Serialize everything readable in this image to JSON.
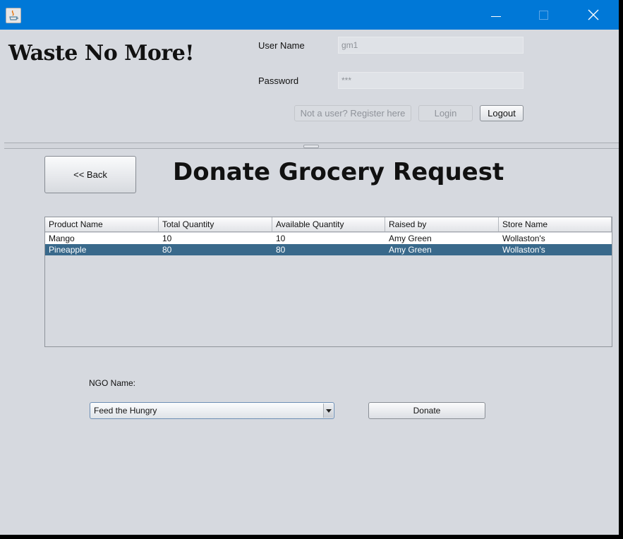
{
  "brand": {
    "title": "Waste No More!"
  },
  "login": {
    "username_label": "User Name",
    "username_value": "gm1",
    "password_label": "Password",
    "password_value": "***",
    "register_label": "Not a user? Register here",
    "login_label": "Login",
    "logout_label": "Logout"
  },
  "page": {
    "back_label": "<< Back",
    "title": "Donate Grocery Request"
  },
  "table": {
    "columns": [
      "Product Name",
      "Total Quantity",
      "Available Quantity",
      "Raised by",
      "Store Name"
    ],
    "rows": [
      [
        "Mango",
        "10",
        "10",
        "Amy Green",
        "Wollaston's"
      ],
      [
        "Pineapple",
        "80",
        "80",
        "Amy Green",
        "Wollaston's"
      ]
    ],
    "selected_row": 1
  },
  "donate": {
    "ngo_label": "NGO Name:",
    "ngo_selected": "Feed the Hungry",
    "donate_label": "Donate"
  },
  "colors": {
    "titlebar": "#0078d7",
    "selection": "#39698b",
    "background": "#d6d9df"
  },
  "icons": [
    "java-app-icon",
    "minimize-icon",
    "maximize-icon",
    "close-icon",
    "chevron-down-icon",
    "split-grip-icon"
  ]
}
